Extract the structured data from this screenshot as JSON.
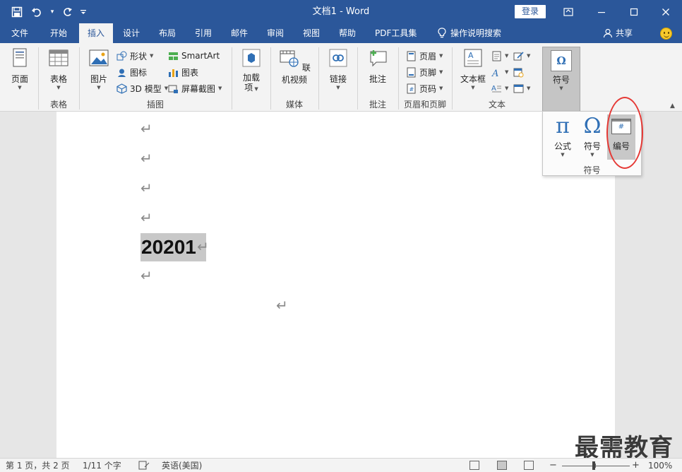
{
  "title": "文档1  -  Word",
  "login_label": "登录",
  "tabs": [
    "文件",
    "开始",
    "插入",
    "设计",
    "布局",
    "引用",
    "邮件",
    "审阅",
    "视图",
    "帮助",
    "PDF工具集"
  ],
  "tell_me": "操作说明搜索",
  "share_label": "共享",
  "ribbon": {
    "page": {
      "label": "页面",
      "group": ""
    },
    "table": {
      "label": "表格",
      "group": "表格"
    },
    "illustrations": {
      "picture": "图片",
      "shapes": "形状",
      "icons": "图标",
      "model3d": "3D 模型",
      "smartart": "SmartArt",
      "chart": "图表",
      "screenshot": "屏幕截图",
      "group": "插图"
    },
    "addins": {
      "label1": "加载",
      "label2": "项",
      "group": ""
    },
    "media": {
      "online_video": "联机视频",
      "group": "媒体"
    },
    "links": {
      "label": "链接",
      "group": ""
    },
    "comments": {
      "label": "批注",
      "group": "批注"
    },
    "header_footer": {
      "header": "页眉",
      "footer": "页脚",
      "page_number": "页码",
      "group": "页眉和页脚"
    },
    "text": {
      "textbox": "文本框",
      "group": "文本"
    },
    "symbols": {
      "label": "符号"
    }
  },
  "dropdown": {
    "equation": "公式",
    "symbol": "符号",
    "number": "编号",
    "group": "符号"
  },
  "document": {
    "selected_text": "20201"
  },
  "status": {
    "page": "第 1 页，共 2 页",
    "words": "1/11 个字",
    "language": "英语(美国)",
    "zoom": "100%"
  },
  "watermark": "最需教育",
  "colors": {
    "accent": "#2b579a",
    "ribbon_bg": "#f3f3f3",
    "annotation": "#e53935"
  }
}
